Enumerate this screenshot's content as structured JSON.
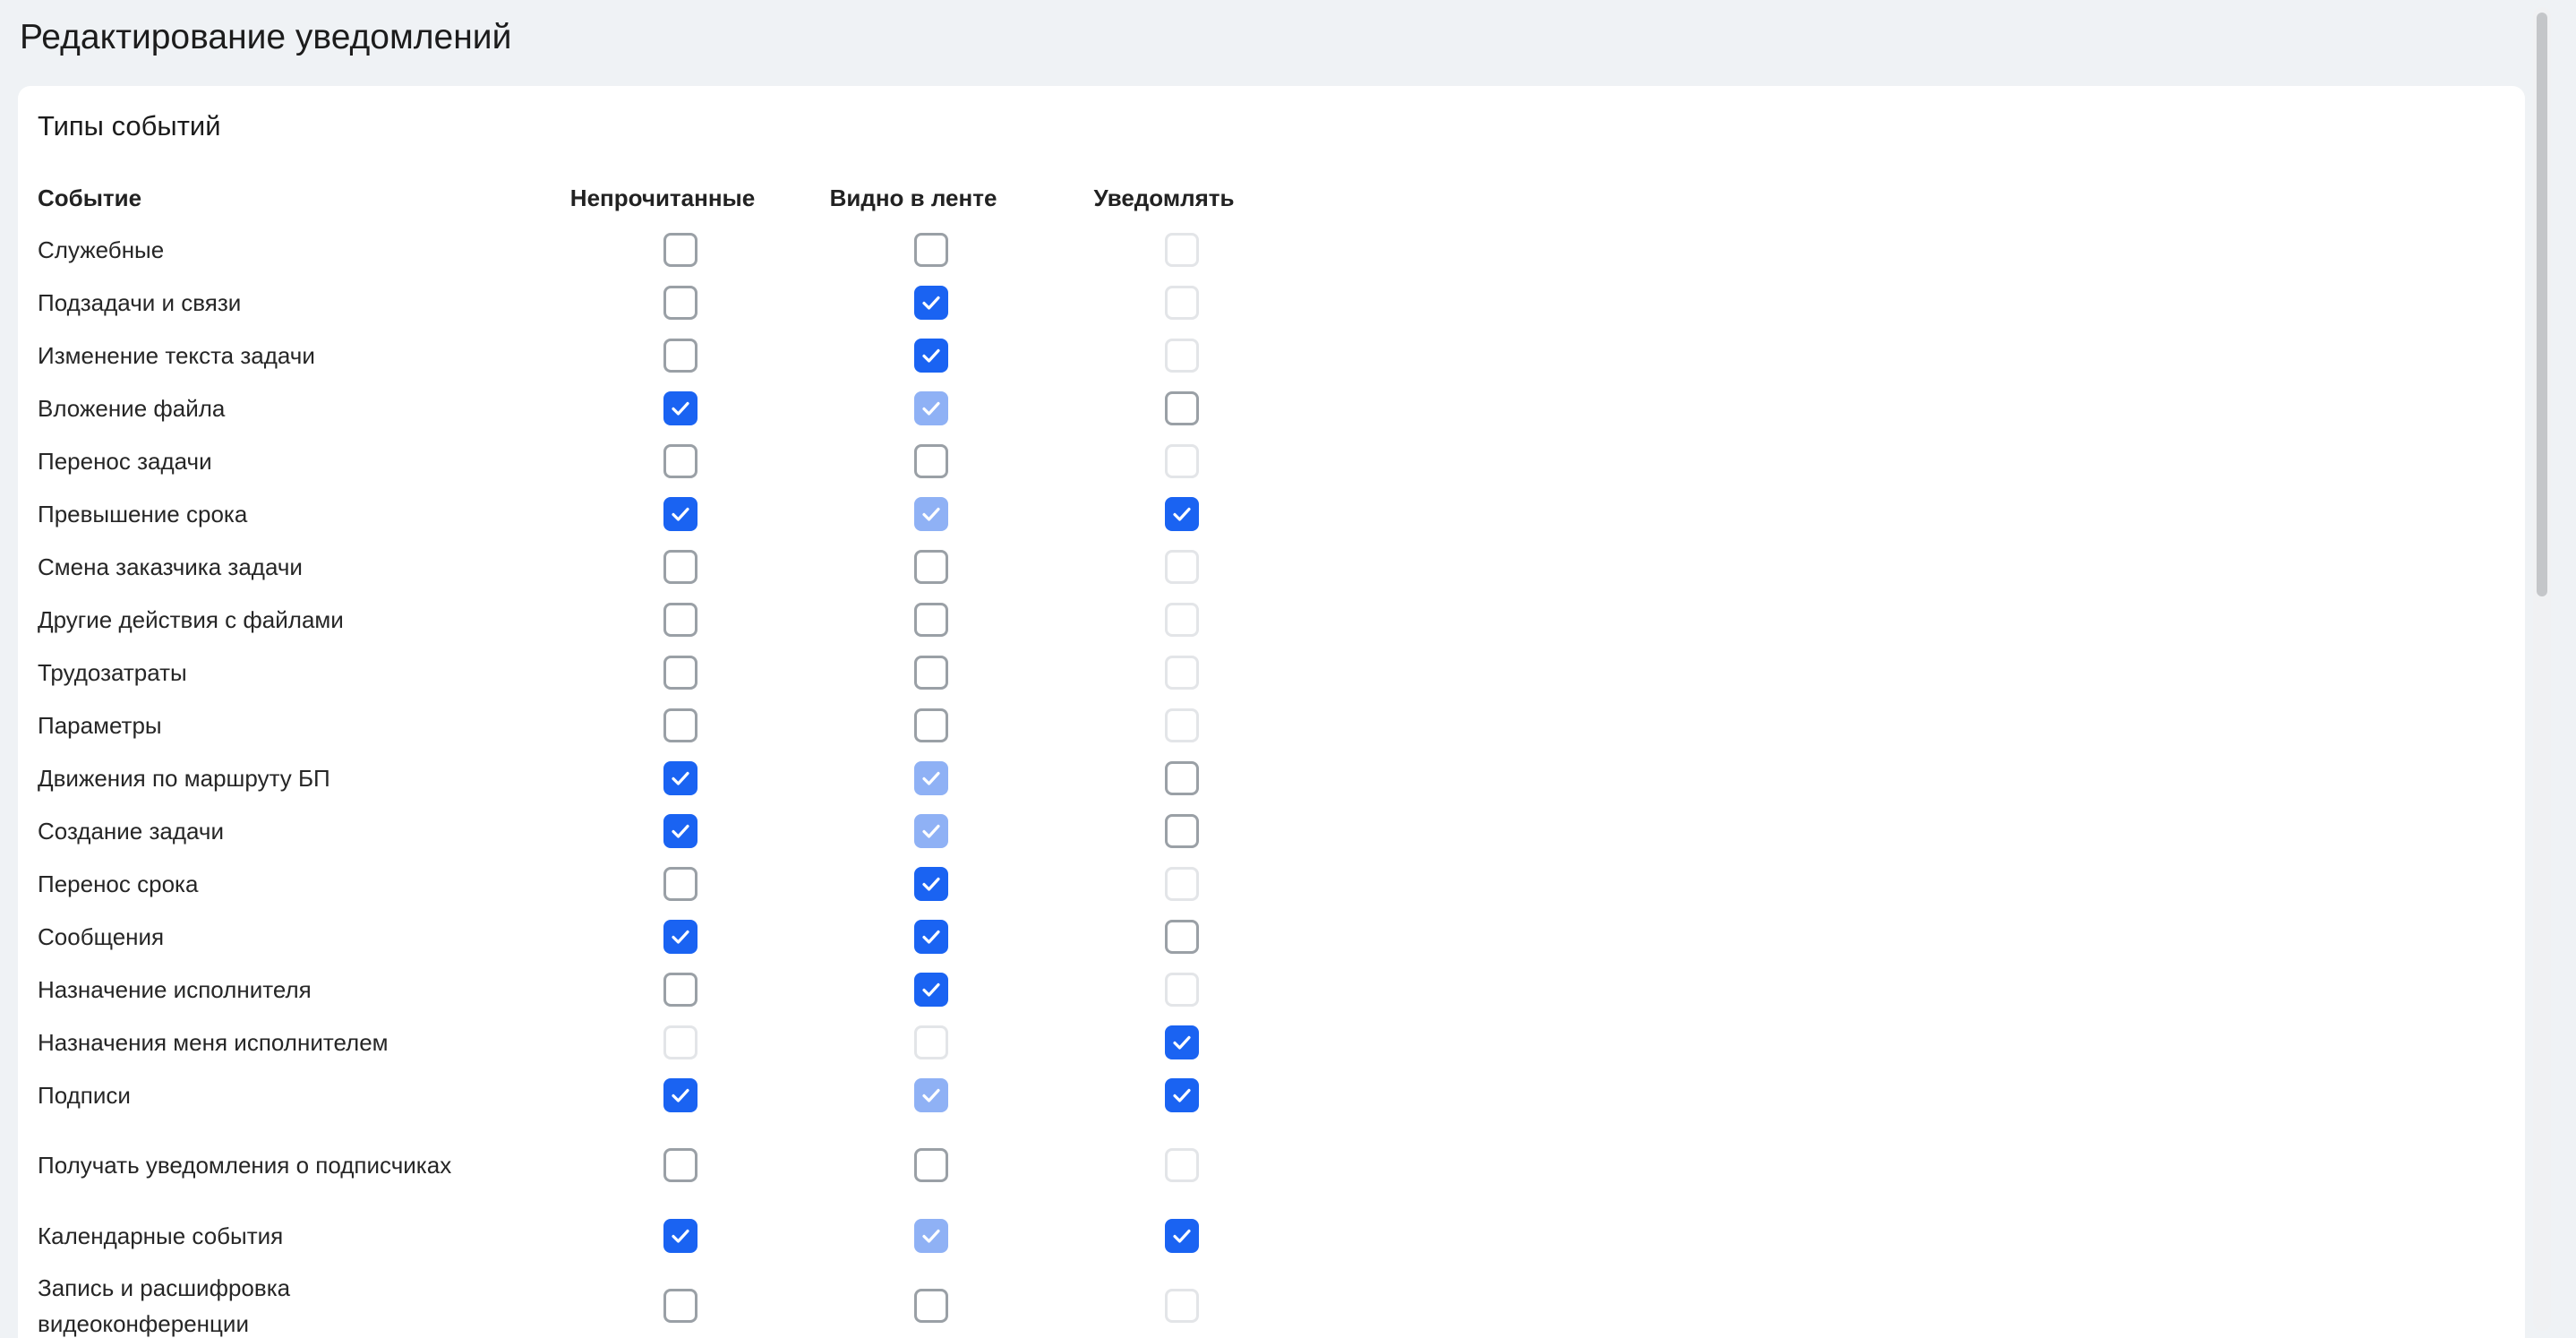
{
  "page": {
    "title": "Редактирование уведомлений"
  },
  "section": {
    "title": "Типы событий"
  },
  "columns": {
    "event": "Событие",
    "unread": "Непрочитанные",
    "feed": "Видно в ленте",
    "notify": "Уведомлять"
  },
  "colors": {
    "checked": "#1a63f2",
    "checked_disabled": "#8fb1f5",
    "border": "#9aa0a6",
    "border_disabled": "#e3e5e8",
    "page_background": "#eff2f5"
  },
  "rows": [
    {
      "label": "Служебные",
      "unread": "off",
      "feed": "off",
      "notify": "disabled"
    },
    {
      "label": "Подзадачи и связи",
      "unread": "off",
      "feed": "on",
      "notify": "disabled"
    },
    {
      "label": "Изменение текста задачи",
      "unread": "off",
      "feed": "on",
      "notify": "disabled"
    },
    {
      "label": "Вложение файла",
      "unread": "on",
      "feed": "on-disabled",
      "notify": "off"
    },
    {
      "label": "Перенос задачи",
      "unread": "off",
      "feed": "off",
      "notify": "disabled"
    },
    {
      "label": "Превышение срока",
      "unread": "on",
      "feed": "on-disabled",
      "notify": "on"
    },
    {
      "label": "Смена заказчика задачи",
      "unread": "off",
      "feed": "off",
      "notify": "disabled"
    },
    {
      "label": "Другие действия с файлами",
      "unread": "off",
      "feed": "off",
      "notify": "disabled"
    },
    {
      "label": "Трудозатраты",
      "unread": "off",
      "feed": "off",
      "notify": "disabled"
    },
    {
      "label": "Параметры",
      "unread": "off",
      "feed": "off",
      "notify": "disabled"
    },
    {
      "label": "Движения по маршруту БП",
      "unread": "on",
      "feed": "on-disabled",
      "notify": "off"
    },
    {
      "label": "Создание задачи",
      "unread": "on",
      "feed": "on-disabled",
      "notify": "off"
    },
    {
      "label": "Перенос срока",
      "unread": "off",
      "feed": "on",
      "notify": "disabled"
    },
    {
      "label": "Сообщения",
      "unread": "on",
      "feed": "on",
      "notify": "off"
    },
    {
      "label": "Назначение исполнителя",
      "unread": "off",
      "feed": "on",
      "notify": "disabled"
    },
    {
      "label": "Назначения меня исполнителем",
      "unread": "disabled",
      "feed": "disabled",
      "notify": "on"
    },
    {
      "label": "Подписи",
      "unread": "on",
      "feed": "on-disabled",
      "notify": "on"
    },
    {
      "label": "Получать уведомления о подписчиках",
      "unread": "off",
      "feed": "off",
      "notify": "disabled"
    },
    {
      "label": "Календарные события",
      "unread": "on",
      "feed": "on-disabled",
      "notify": "on"
    },
    {
      "label": "Запись и расшифровка видеоконференции",
      "unread": "off",
      "feed": "off",
      "notify": "disabled"
    }
  ]
}
